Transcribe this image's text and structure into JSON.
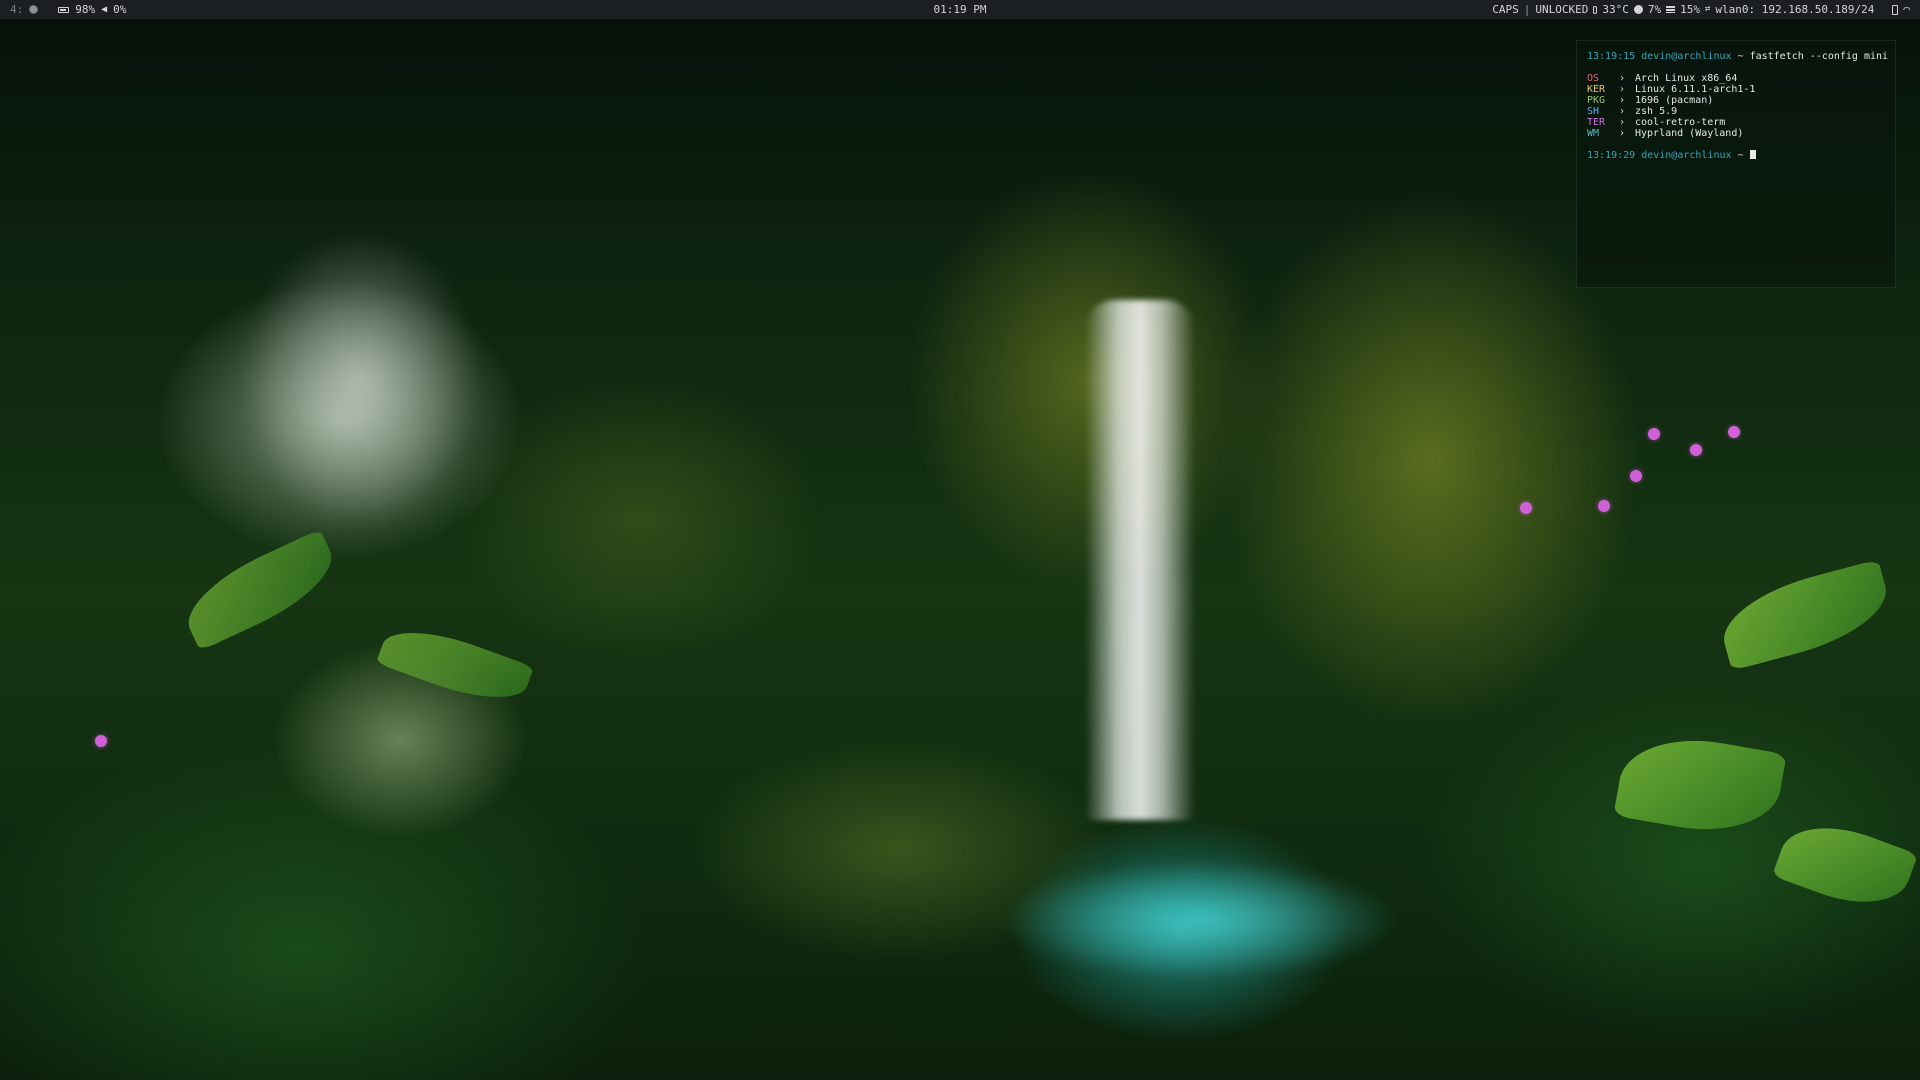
{
  "topbar": {
    "workspace": "4:",
    "battery": "98%",
    "volume": "0%",
    "clock": "01:19 PM",
    "caps": "CAPS",
    "sep": "|",
    "lock_state": "UNLOCKED",
    "temperature": "33°C",
    "cpu": "7%",
    "memory": "15%",
    "network": "wlan0: 192.168.50.189/24"
  },
  "terminal": {
    "prompt1": {
      "time": "13:19:15",
      "user_host": "devin@archlinux",
      "cwd": " ~ ",
      "command": "fastfetch --config mini"
    },
    "fastfetch": [
      {
        "key": "OS",
        "arrow": "›",
        "value": "Arch Linux x86_64"
      },
      {
        "key": "KER",
        "arrow": "›",
        "value": "Linux 6.11.1-arch1-1"
      },
      {
        "key": "PKG",
        "arrow": "›",
        "value": "1696 (pacman)"
      },
      {
        "key": "SH",
        "arrow": "›",
        "value": "zsh 5.9"
      },
      {
        "key": "TER",
        "arrow": "›",
        "value": "cool-retro-term"
      },
      {
        "key": "WM",
        "arrow": "›",
        "value": "Hyprland (Wayland)"
      }
    ],
    "prompt2": {
      "time": "13:19:29",
      "user_host": "devin@archlinux",
      "cwd": " ~ "
    }
  },
  "icons": {
    "workspace_indicator": "dot-icon",
    "battery": "battery-icon",
    "volume": "speaker-icon",
    "temperature": "thermometer-icon",
    "cpu": "cpu-icon",
    "memory": "memory-icon",
    "network": "network-icon",
    "phone": "phone-icon",
    "wifi": "wifi-icon"
  },
  "colors": {
    "bar_background": "#1b1f23",
    "prompt_accent": "#36a3b8",
    "os_key": "#e06c75",
    "ker_key": "#e5c07b",
    "pkg_key": "#98c379",
    "sh_key": "#61afef",
    "ter_key": "#c678dd",
    "wm_key": "#56b6c2"
  }
}
